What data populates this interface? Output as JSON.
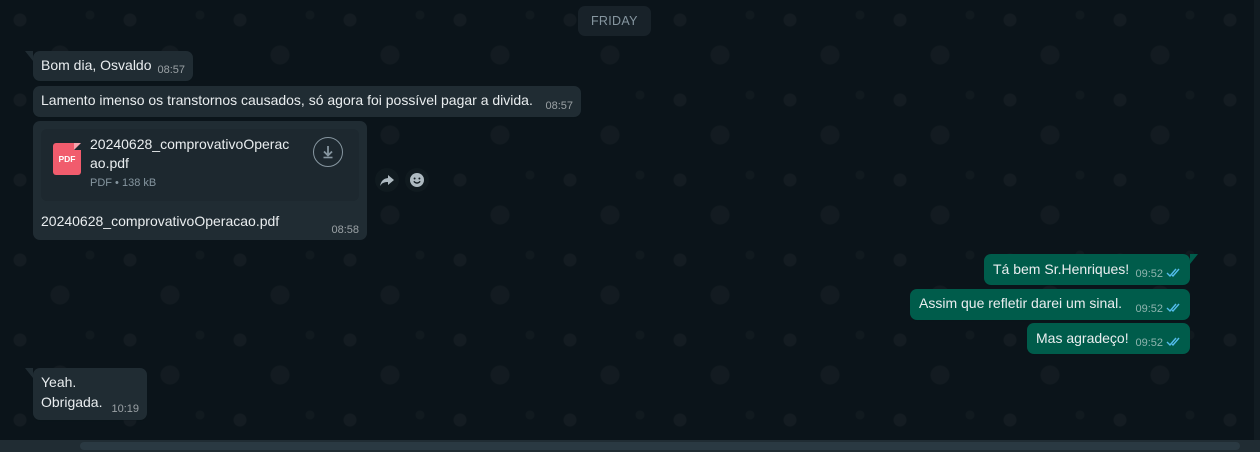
{
  "day_divider": "FRIDAY",
  "incoming": [
    {
      "text": "Bom dia, Osvaldo",
      "time": "08:57"
    },
    {
      "text": "Lamento imenso os transtornos causados, só agora foi possível pagar a divida.",
      "time": "08:57"
    }
  ],
  "document": {
    "file_name_line1": "20240628_comprovativoOperac",
    "file_name_line2": "ao.pdf",
    "icon_label": "PDF",
    "meta": "PDF • 138 kB",
    "caption": "20240628_comprovativoOperacao.pdf",
    "time": "08:58",
    "icons": {
      "download": "download-icon",
      "forward": "forward-icon",
      "react": "emoji-icon"
    }
  },
  "outgoing": [
    {
      "text": "Tá bem Sr.Henriques!",
      "time": "09:52"
    },
    {
      "text": "Assim que refletir darei um sinal.",
      "time": "09:52"
    },
    {
      "text": "Mas agradeço!",
      "time": "09:52"
    }
  ],
  "last_incoming": {
    "line1": "Yeah.",
    "line2": "Obrigada.",
    "time": "10:19"
  },
  "colors": {
    "background": "#0b141a",
    "incoming_bubble": "#202c33",
    "outgoing_bubble": "#005c4b",
    "read_tick": "#53bdeb",
    "pdf_red": "#f15c6d"
  }
}
